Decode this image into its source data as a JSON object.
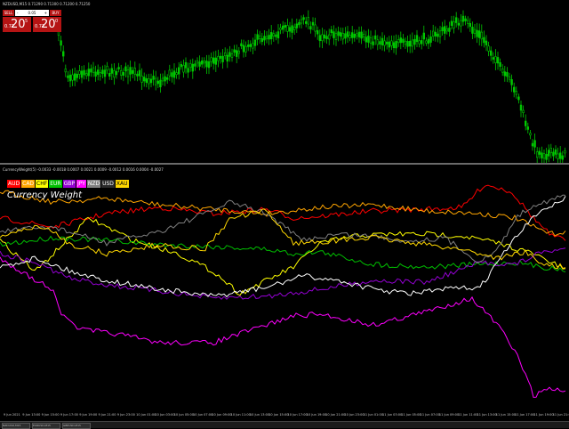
{
  "window": {
    "price_header": "NZDUSD,M15  0.71290 0.71300 0.71200 0.71250",
    "indicator_header": "CurrencyWeight(5) -0.0033 -0.0018 0.0007 0.0021 0.0009 -0.0012 0.0016 0.0004 -0.0027",
    "chart_tabs": [
      "NZDUSD,M15",
      "EURUSD,M15",
      "GBPUSD,M15"
    ]
  },
  "trade_panel": {
    "sell_label": "SELL",
    "buy_label": "BUY",
    "lot_value": "0.05",
    "minus": "-",
    "plus": "+",
    "sell_prefix": "0.71",
    "sell_big": "20",
    "sell_sup": "5",
    "buy_prefix": "0.71",
    "buy_big": "20",
    "buy_sup": "0"
  },
  "indicator": {
    "title": "Currency Weight",
    "legend": [
      {
        "code": "AUD",
        "color": "#ff0000"
      },
      {
        "code": "CAD",
        "color": "#ffa500"
      },
      {
        "code": "CHF",
        "color": "#ffff00"
      },
      {
        "code": "EUR",
        "color": "#00c000"
      },
      {
        "code": "GBP",
        "color": "#9400d3"
      },
      {
        "code": "JPY",
        "color": "#ff00ff"
      },
      {
        "code": "NZD",
        "color": "#808080"
      },
      {
        "code": "USD",
        "color": "#ffffff"
      },
      {
        "code": "XAU",
        "color": "#ffd700"
      }
    ]
  },
  "time_axis": [
    "9 Jun 2021",
    "9 Jun 13:00",
    "9 Jun 15:00",
    "9 Jun 17:00",
    "9 Jun 19:00",
    "9 Jun 21:00",
    "9 Jun 23:00",
    "10 Jun 01:00",
    "10 Jun 03:00",
    "10 Jun 05:00",
    "10 Jun 07:00",
    "10 Jun 09:00",
    "10 Jun 11:00",
    "10 Jun 13:00",
    "10 Jun 15:00",
    "10 Jun 17:00",
    "10 Jun 19:00",
    "10 Jun 21:00",
    "10 Jun 23:00",
    "11 Jun 01:00",
    "11 Jun 03:00",
    "11 Jun 05:00",
    "11 Jun 07:00",
    "11 Jun 09:00",
    "11 Jun 11:00",
    "11 Jun 13:00",
    "11 Jun 15:00",
    "11 Jun 17:00",
    "11 Jun 19:00",
    "11 Jun 21:00"
  ],
  "series_colors": {
    "bull_candle": "#00c800",
    "bear_candle": "#00c800"
  }
}
